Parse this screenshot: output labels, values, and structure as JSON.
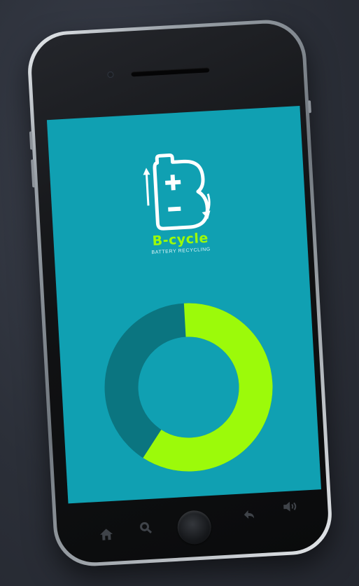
{
  "app": {
    "brand_name": "B-cycle",
    "tagline": "BATTERY RECYCLING"
  },
  "colors": {
    "screen_bg": "#10a0b2",
    "accent_green": "#9cfa0a",
    "donut_dark": "#0b7580"
  },
  "donut": {
    "filled_fraction": 0.6
  },
  "nav": {
    "home_icon": "home-icon",
    "search_icon": "search-icon",
    "home_button": "home-button",
    "back_icon": "back-icon",
    "volume_icon": "volume-icon"
  }
}
